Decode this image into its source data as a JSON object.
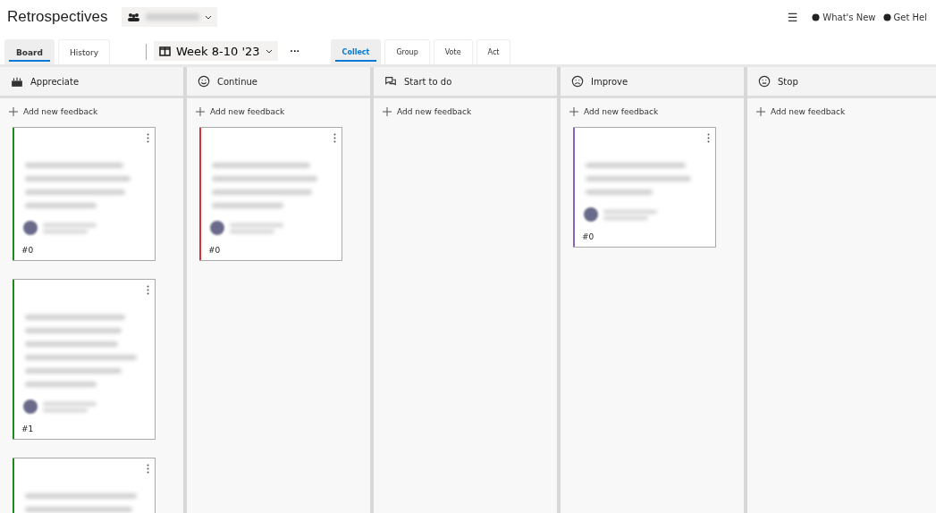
{
  "app": {
    "title": "Retrospectives"
  },
  "header_links": [
    {
      "kind": "menu",
      "label": "☰"
    },
    {
      "kind": "news",
      "label": "What's New"
    },
    {
      "kind": "help",
      "label": "Get Hel"
    }
  ],
  "view_tabs": [
    {
      "label": "Board",
      "selected": true
    },
    {
      "label": "History",
      "selected": false
    }
  ],
  "board_selector": {
    "label": "Week 8-10 '23"
  },
  "more": "···",
  "phase_tabs": [
    {
      "label": "Collect",
      "selected": true
    },
    {
      "label": "Group",
      "selected": false
    },
    {
      "label": "Vote",
      "selected": false
    },
    {
      "label": "Act",
      "selected": false
    }
  ],
  "columns": [
    {
      "kind": "cake",
      "title": "Appreciate",
      "add_label": "Add new feedback",
      "cards": [
        {
          "color": "#1a8a1a",
          "number": "#0"
        },
        {
          "color": "#1a8a1a",
          "number": "#1"
        },
        {
          "color": "#1a8a1a"
        }
      ]
    },
    {
      "kind": "smile",
      "title": "Continue",
      "add_label": "Add new feedback",
      "cards": [
        {
          "color": "#d13438",
          "number": "#0"
        }
      ]
    },
    {
      "kind": "chat",
      "title": "Start to do",
      "add_label": "Add new feedback"
    },
    {
      "kind": "frown",
      "title": "Improve",
      "add_label": "Add new feedback",
      "cards": [
        {
          "color": "#8764b8",
          "number": "#0"
        }
      ]
    },
    {
      "kind": "stop",
      "title": "Stop",
      "add_label": "Add new feedback"
    }
  ]
}
